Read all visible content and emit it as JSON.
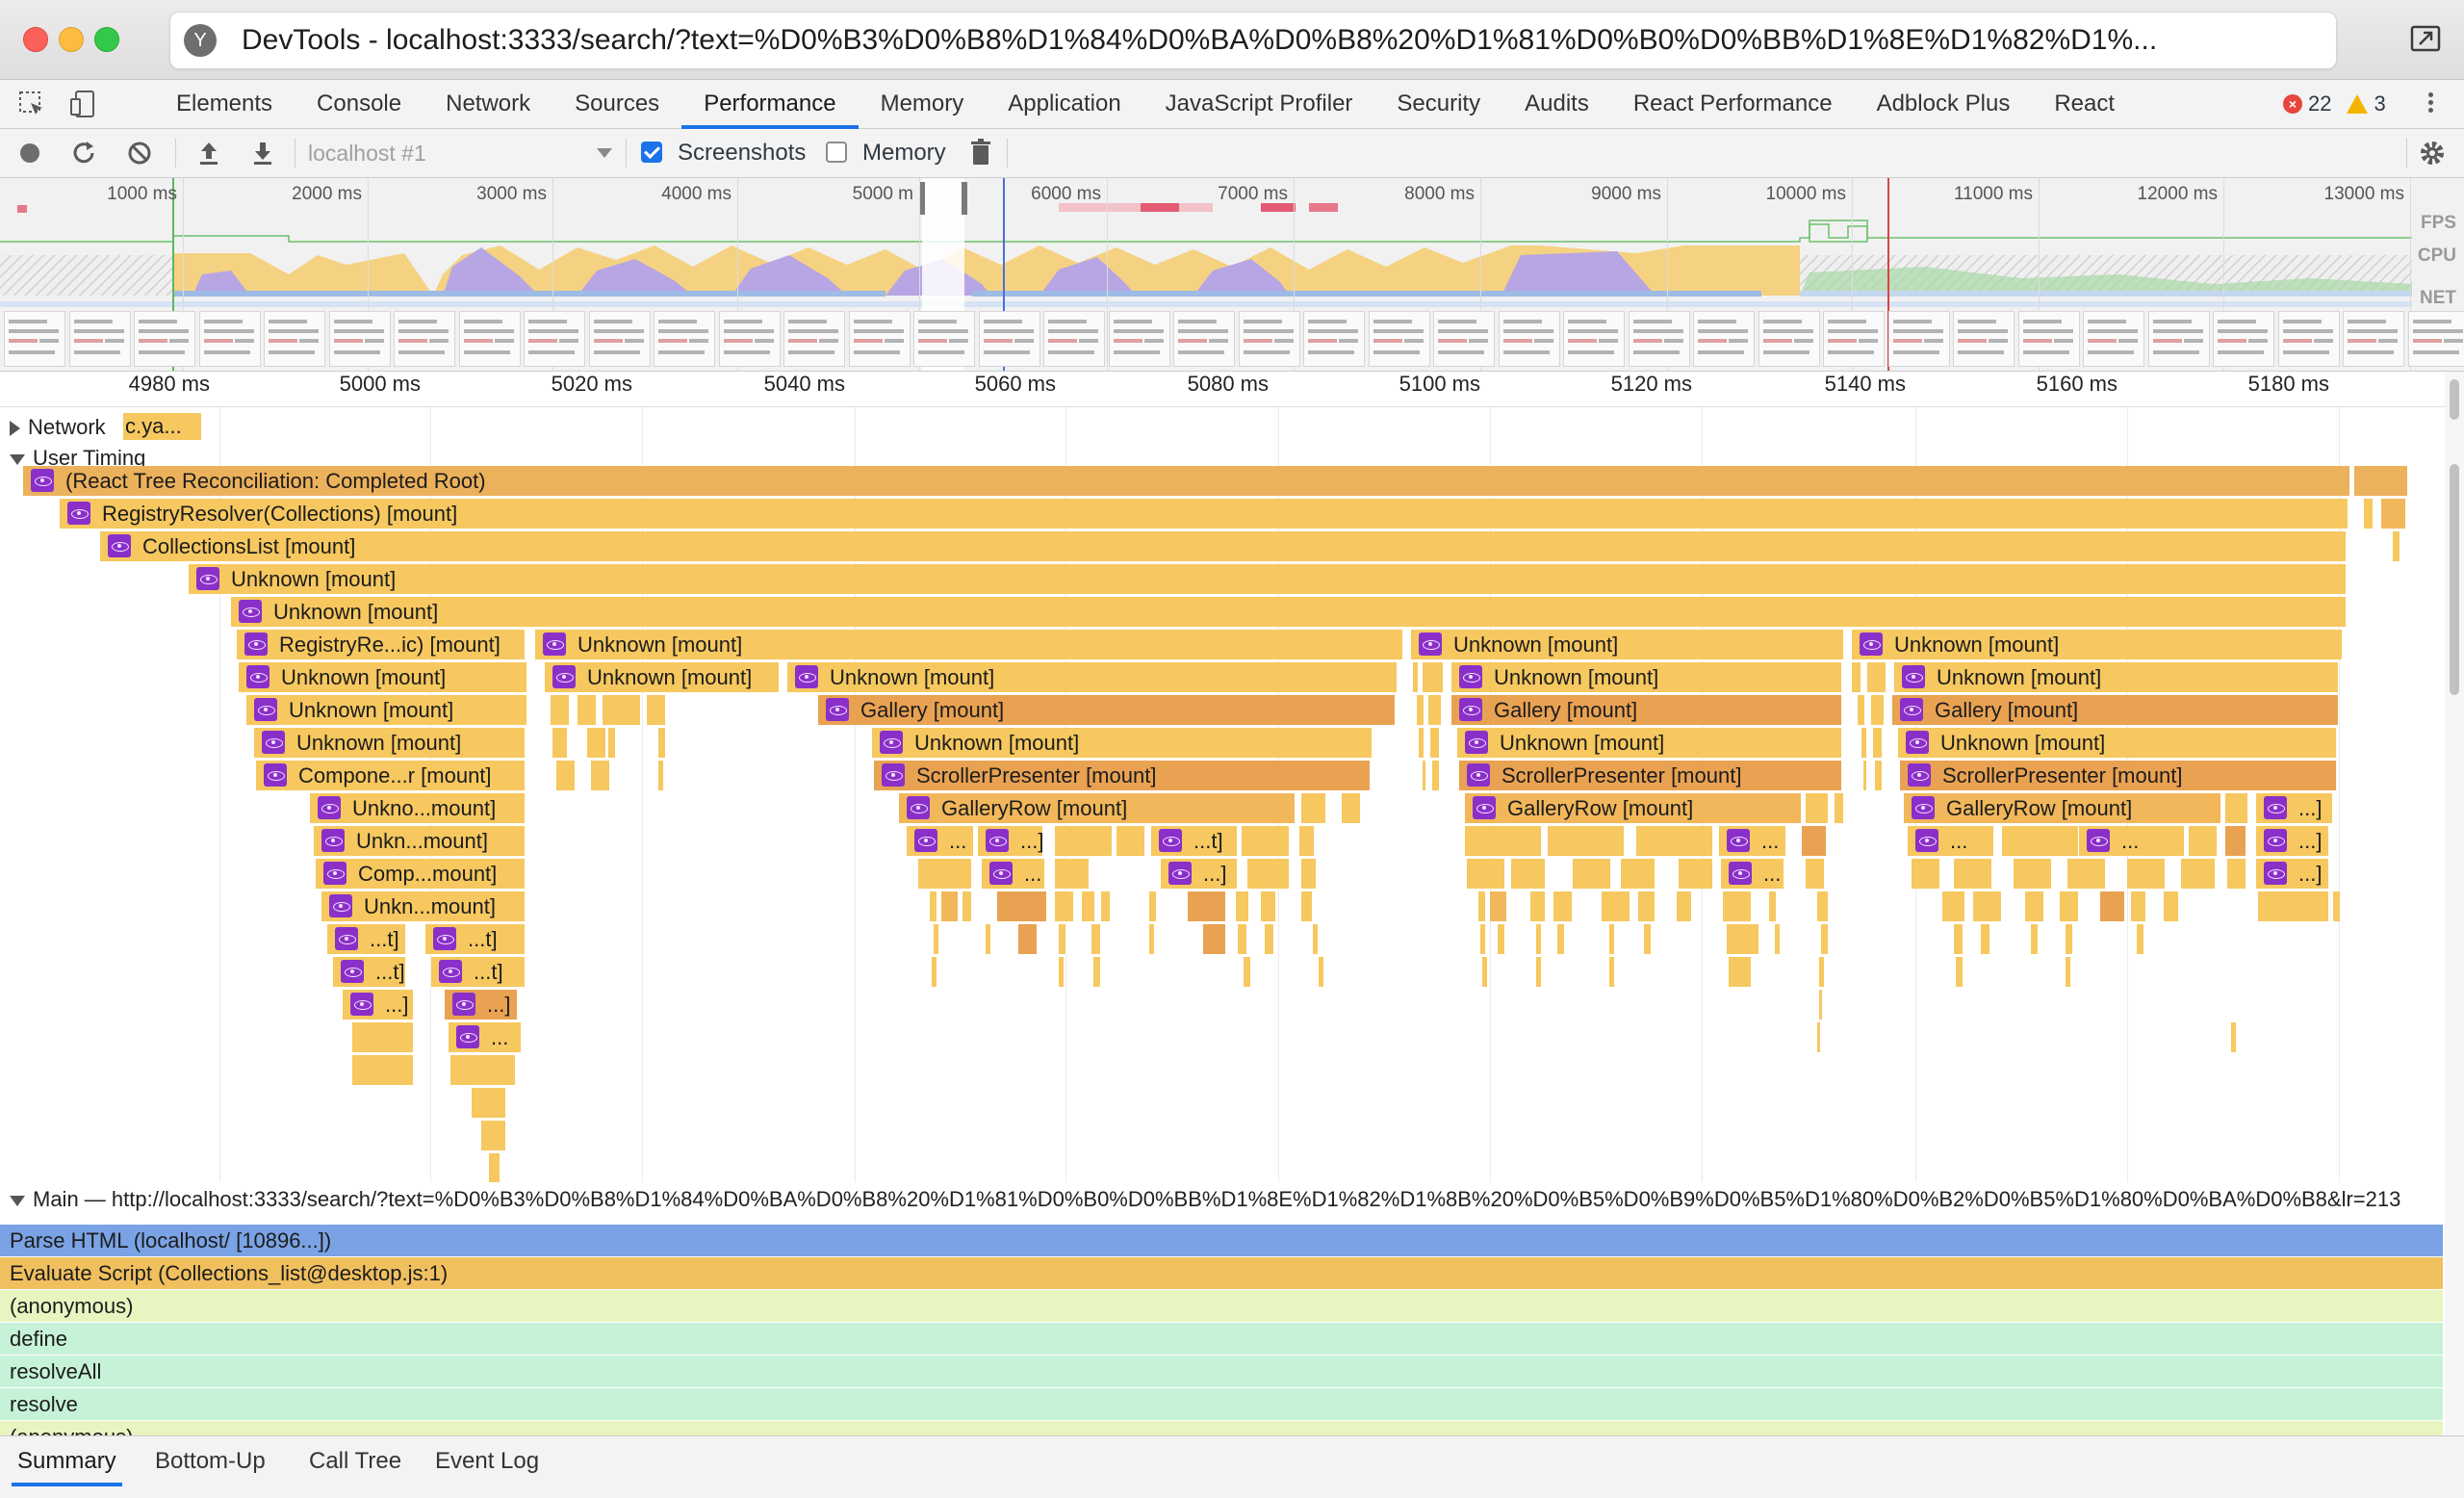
{
  "window": {
    "title": "DevTools - localhost:3333/search/?text=%D0%B3%D0%B8%D1%84%D0%BA%D0%B8%20%D1%81%D0%B0%D0%BB%D1%8E%D1%82%D1%..."
  },
  "tabs": [
    {
      "label": "Elements"
    },
    {
      "label": "Console"
    },
    {
      "label": "Network"
    },
    {
      "label": "Sources"
    },
    {
      "label": "Performance",
      "active": true
    },
    {
      "label": "Memory"
    },
    {
      "label": "Application"
    },
    {
      "label": "JavaScript Profiler"
    },
    {
      "label": "Security"
    },
    {
      "label": "Audits"
    },
    {
      "label": "React Performance"
    },
    {
      "label": "Adblock Plus"
    },
    {
      "label": "React"
    }
  ],
  "status": {
    "errors": "22",
    "warnings": "3"
  },
  "toolbar": {
    "profile_placeholder": "localhost #1",
    "screenshots_label": "Screenshots",
    "screenshots_checked": true,
    "memory_label": "Memory",
    "memory_checked": false
  },
  "overview": {
    "ticks": [
      "1000 ms",
      "2000 ms",
      "3000 ms",
      "4000 ms",
      "5000 m",
      "6000 ms",
      "7000 ms",
      "8000 ms",
      "9000 ms",
      "10000 ms",
      "11000 ms",
      "12000 ms",
      "13000 ms"
    ],
    "lanes": [
      "FPS",
      "CPU",
      "NET"
    ]
  },
  "ruler": {
    "ticks": [
      "4980 ms",
      "5000 ms",
      "5020 ms",
      "5040 ms",
      "5060 ms",
      "5080 ms",
      "5100 ms",
      "5120 ms",
      "5140 ms",
      "5160 ms",
      "5180 ms"
    ]
  },
  "tracks": {
    "network_label": "Network",
    "network_item": "c.ya...",
    "user_timing_label": "User Timing"
  },
  "flame": {
    "root": "(React Tree Reconciliation: Completed Root)",
    "registry": "RegistryResolver(Collections) [mount]",
    "collections": "CollectionsList [mount]",
    "unknown": "Unknown [mount]",
    "registry_short": "RegistryRe...ic) [mount]",
    "gallery": "Gallery [mount]",
    "scroller": "ScrollerPresenter [mount]",
    "gallery_row": "GalleryRow [mount]",
    "component_short": "Compone...r [mount]",
    "unkno_short": "Unkno...mount]",
    "unkn_short": "Unkn...mount]",
    "comp_short": "Comp...mount]",
    "t_short": "...t]",
    "bracket_short": "...]",
    "ellipsis": "..."
  },
  "main": {
    "header": "Main — http://localhost:3333/search/?text=%D0%B3%D0%B8%D1%84%D0%BA%D0%B8%20%D1%81%D0%B0%D0%BB%D1%8E%D1%82%D1%8B%20%D0%B5%D0%B9%D0%B5%D1%80%D0%B2%D0%B5%D1%80%D0%BA%D0%B8&lr=213",
    "rows": [
      {
        "label": "Parse HTML (localhost/ [10896...])",
        "color": "#7aa3e5"
      },
      {
        "label": "Evaluate Script (Collections_list@desktop.js:1)",
        "color": "#f0c05f"
      },
      {
        "label": "(anonymous)",
        "color": "#e8f5c0"
      },
      {
        "label": "define",
        "color": "#c6f2d8"
      },
      {
        "label": "resolveAll",
        "color": "#c6f2d8"
      },
      {
        "label": "resolve",
        "color": "#c6f2d8"
      },
      {
        "label": "(anonymous)",
        "color": "#e8f5c0"
      }
    ]
  },
  "bottom_tabs": [
    "Summary",
    "Bottom-Up",
    "Call Tree",
    "Event Log"
  ],
  "colors": {
    "accent": "#1a73e8",
    "error": "#e8453c",
    "warning": "#f4b400",
    "react_icon": "#8b2fc9"
  }
}
